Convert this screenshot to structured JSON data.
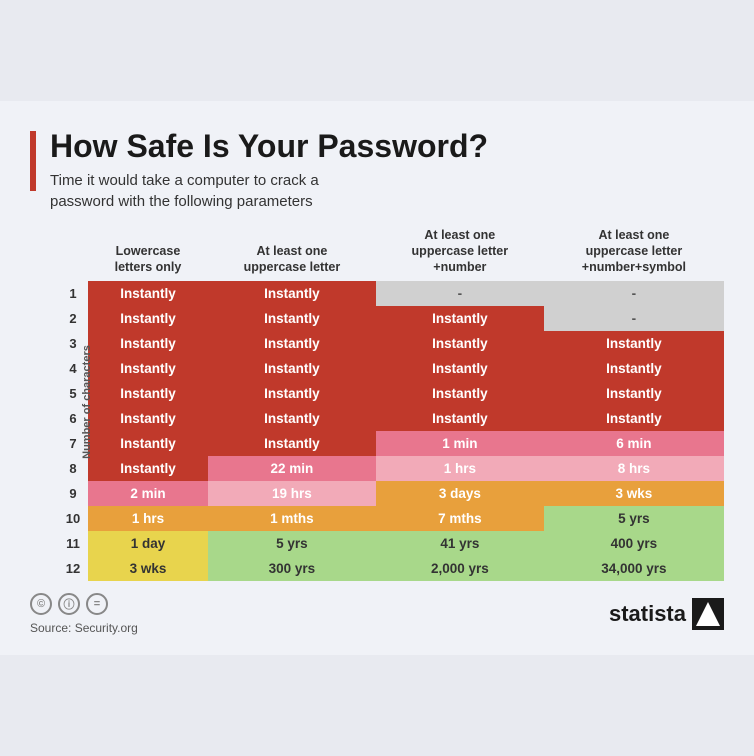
{
  "title": "How Safe Is Your Password?",
  "subtitle": "Time it would take a computer to crack a\npassword with the following parameters",
  "columns": [
    "",
    "Lowercase\nletters only",
    "At least one\nuppercase letter",
    "At least one\nuppercase letter\n+number",
    "At least one\nuppercase letter\n+number+symbol"
  ],
  "row_label": "Number of characters",
  "rows": [
    {
      "num": "1",
      "c1": "Instantly",
      "c1_cls": "c-red",
      "c2": "Instantly",
      "c2_cls": "c-red",
      "c3": "-",
      "c3_cls": "c-gray",
      "c4": "-",
      "c4_cls": "c-gray"
    },
    {
      "num": "2",
      "c1": "Instantly",
      "c1_cls": "c-red",
      "c2": "Instantly",
      "c2_cls": "c-red",
      "c3": "Instantly",
      "c3_cls": "c-red",
      "c4": "-",
      "c4_cls": "c-gray"
    },
    {
      "num": "3",
      "c1": "Instantly",
      "c1_cls": "c-red",
      "c2": "Instantly",
      "c2_cls": "c-red",
      "c3": "Instantly",
      "c3_cls": "c-red",
      "c4": "Instantly",
      "c4_cls": "c-red"
    },
    {
      "num": "4",
      "c1": "Instantly",
      "c1_cls": "c-red",
      "c2": "Instantly",
      "c2_cls": "c-red",
      "c3": "Instantly",
      "c3_cls": "c-red",
      "c4": "Instantly",
      "c4_cls": "c-red"
    },
    {
      "num": "5",
      "c1": "Instantly",
      "c1_cls": "c-red",
      "c2": "Instantly",
      "c2_cls": "c-red",
      "c3": "Instantly",
      "c3_cls": "c-red",
      "c4": "Instantly",
      "c4_cls": "c-red"
    },
    {
      "num": "6",
      "c1": "Instantly",
      "c1_cls": "c-red",
      "c2": "Instantly",
      "c2_cls": "c-red",
      "c3": "Instantly",
      "c3_cls": "c-red",
      "c4": "Instantly",
      "c4_cls": "c-red"
    },
    {
      "num": "7",
      "c1": "Instantly",
      "c1_cls": "c-red",
      "c2": "Instantly",
      "c2_cls": "c-red",
      "c3": "1 min",
      "c3_cls": "c-pink",
      "c4": "6 min",
      "c4_cls": "c-pink"
    },
    {
      "num": "8",
      "c1": "Instantly",
      "c1_cls": "c-red",
      "c2": "22 min",
      "c2_cls": "c-pink",
      "c3": "1 hrs",
      "c3_cls": "c-lpink",
      "c4": "8 hrs",
      "c4_cls": "c-lpink"
    },
    {
      "num": "9",
      "c1": "2 min",
      "c1_cls": "c-pink",
      "c2": "19 hrs",
      "c2_cls": "c-lpink",
      "c3": "3 days",
      "c3_cls": "c-orange",
      "c4": "3 wks",
      "c4_cls": "c-orange"
    },
    {
      "num": "10",
      "c1": "1 hrs",
      "c1_cls": "c-orange",
      "c2": "1 mths",
      "c2_cls": "c-orange",
      "c3": "7 mths",
      "c3_cls": "c-orange",
      "c4": "5 yrs",
      "c4_cls": "c-lgreen"
    },
    {
      "num": "11",
      "c1": "1 day",
      "c1_cls": "c-yellow",
      "c2": "5 yrs",
      "c2_cls": "c-lgreen",
      "c3": "41 yrs",
      "c3_cls": "c-lgreen",
      "c4": "400 yrs",
      "c4_cls": "c-lgreen"
    },
    {
      "num": "12",
      "c1": "3 wks",
      "c1_cls": "c-yellow",
      "c2": "300 yrs",
      "c2_cls": "c-lgreen",
      "c3": "2,000 yrs",
      "c3_cls": "c-lgreen",
      "c4": "34,000 yrs",
      "c4_cls": "c-lgreen"
    }
  ],
  "source": "Source: Security.org",
  "brand": "statista"
}
